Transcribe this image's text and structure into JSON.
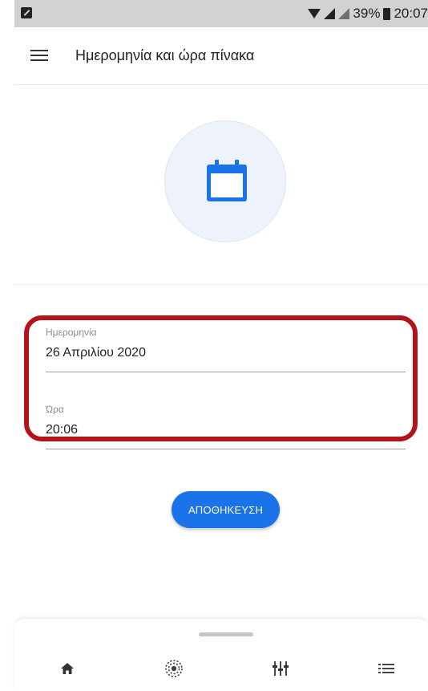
{
  "status_bar": {
    "battery": "39%",
    "time": "20:07"
  },
  "app_bar": {
    "title": "Ημερομηνία και ώρα πίνακα"
  },
  "form": {
    "date_label": "Ημερομηνία",
    "date_value": "26 Απριλίου 2020",
    "time_label": "Ώρα",
    "time_value": "20:06"
  },
  "save_button": {
    "label": "ΑΠΟΘΗΚΕΥΣΗ"
  },
  "bottom_nav": {
    "items": [
      "home-icon",
      "scan-icon",
      "mixer-icon",
      "list-icon"
    ]
  },
  "colors": {
    "accent": "#1a73e8",
    "highlight": "#b3141c"
  }
}
